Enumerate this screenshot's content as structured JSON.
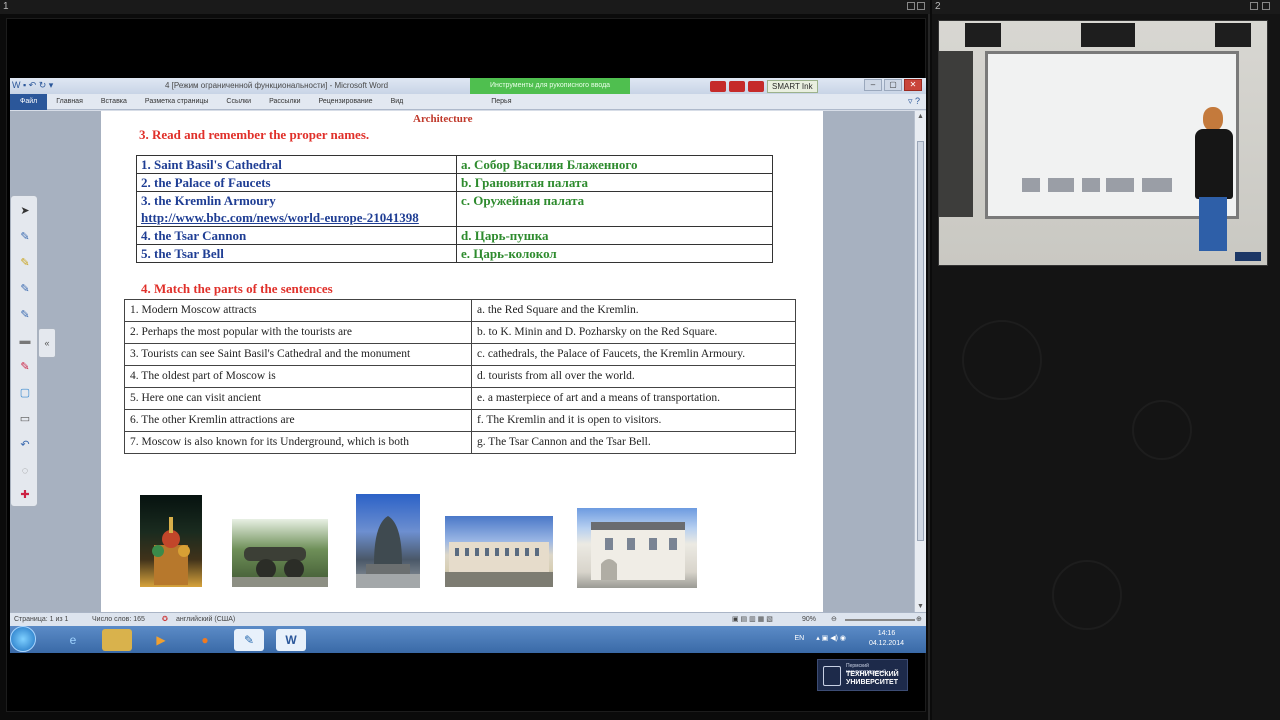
{
  "panes": {
    "pane1_number": "1",
    "pane2_number": "2"
  },
  "word": {
    "window_title": "4 [Режим ограниченной функциональности] - Microsoft Word",
    "context_tab": "Инструменты для рукописного ввода",
    "context_subtab": "Перья",
    "smart_ink": "SMART Ink",
    "tabs": [
      "Файл",
      "Главная",
      "Вставка",
      "Разметка страницы",
      "Ссылки",
      "Рассылки",
      "Рецензирование",
      "Вид"
    ]
  },
  "document": {
    "heading": "Architecture",
    "section3_title": "3. Read  and remember the proper names.",
    "names_table": [
      {
        "en": "1. Saint Basil's Cathedral",
        "ru": "a. Собор Василия Блаженного"
      },
      {
        "en": "2. the Palace of Faucets",
        "ru": "b. Грановитая палата"
      },
      {
        "en": "3. the Kremlin Armoury",
        "link": "http://www.bbc.com/news/world-europe-21041398",
        "ru": "c. Оружейная палата"
      },
      {
        "en": "4. the Tsar Cannon",
        "ru": "d. Царь-пушка"
      },
      {
        "en": "5. the Tsar Bell",
        "ru": "e. Царь-колокол"
      }
    ],
    "section4_title": "4. Match the parts of the sentences",
    "match_table": [
      {
        "left": "1. Modern Moscow attracts",
        "right": "a. the Red Square and the Kremlin."
      },
      {
        "left": "2. Perhaps the most popular with the tourists are",
        "right": "b. to K. Minin and D. Pozharsky on the Red Square."
      },
      {
        "left": "3. Tourists can see Saint Basil's Cathedral  and the monument",
        "right": "c. cathedrals, the Palace of Faucets, the Kremlin Armoury."
      },
      {
        "left": "4. The oldest part of Moscow is",
        "right": "d. tourists from all over the world."
      },
      {
        "left": "5. Here one can visit ancient",
        "right": "e. a masterpiece of art and a means of transportation."
      },
      {
        "left": "6. The other Kremlin attractions are",
        "right": "f. The Kremlin and it is open to visitors."
      },
      {
        "left": "7. Moscow is also known for its Underground, which is both",
        "right": "g. The Tsar Cannon and the Tsar Bell."
      }
    ]
  },
  "statusbar": {
    "page": "Страница: 1 из 1",
    "words": "Число слов: 165",
    "language": "английский (США)",
    "zoom": "90%"
  },
  "taskbar": {
    "lang": "EN",
    "time": "14:16",
    "date": "04.12.2014"
  },
  "logo": {
    "small_text": "Пермский государственный",
    "line1": "ТЕХНИЧЕСКИЙ",
    "line2": "УНИВЕРСИТЕТ"
  }
}
